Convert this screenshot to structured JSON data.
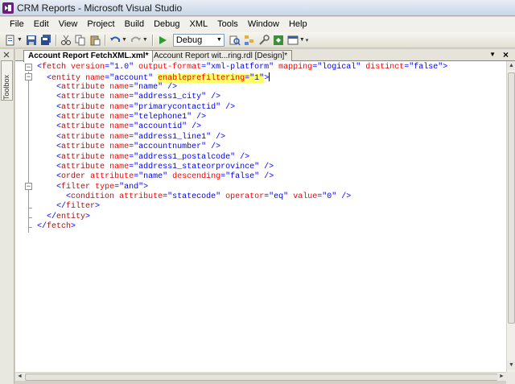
{
  "window": {
    "title": "CRM Reports - Microsoft Visual Studio"
  },
  "menu": [
    "File",
    "Edit",
    "View",
    "Project",
    "Build",
    "Debug",
    "XML",
    "Tools",
    "Window",
    "Help"
  ],
  "toolbar": {
    "configuration": "Debug"
  },
  "toolbox": {
    "label": "Toolbox"
  },
  "tabs": [
    {
      "label": "Account Report FetchXML.xml*",
      "active": true
    },
    {
      "label": "Account Report wit...ring.rdl [Design]*",
      "active": false
    }
  ],
  "tab_close": "×",
  "code_lines": [
    {
      "indent": 0,
      "tokens": [
        [
          "b",
          "<"
        ],
        [
          "t",
          "fetch"
        ],
        [
          "s",
          " "
        ],
        [
          "a",
          "version"
        ],
        [
          "b",
          "="
        ],
        [
          "v",
          "\"1.0\""
        ],
        [
          "s",
          " "
        ],
        [
          "a",
          "output-format"
        ],
        [
          "b",
          "="
        ],
        [
          "v",
          "\"xml-platform\""
        ],
        [
          "s",
          " "
        ],
        [
          "a",
          "mapping"
        ],
        [
          "b",
          "="
        ],
        [
          "v",
          "\"logical\""
        ],
        [
          "s",
          " "
        ],
        [
          "a",
          "distinct"
        ],
        [
          "b",
          "="
        ],
        [
          "v",
          "\"false\""
        ],
        [
          "b",
          ">"
        ]
      ]
    },
    {
      "indent": 1,
      "tokens": [
        [
          "b",
          "<"
        ],
        [
          "t",
          "entity"
        ],
        [
          "s",
          " "
        ],
        [
          "a",
          "name"
        ],
        [
          "b",
          "="
        ],
        [
          "v",
          "\"account\""
        ],
        [
          "s",
          " "
        ],
        [
          "ha",
          "enableprefiltering"
        ],
        [
          "hb",
          "="
        ],
        [
          "hv",
          "\"1\""
        ],
        [
          "b",
          ">"
        ],
        [
          "caret",
          ""
        ]
      ]
    },
    {
      "indent": 2,
      "tokens": [
        [
          "b",
          "<"
        ],
        [
          "t",
          "attribute"
        ],
        [
          "s",
          " "
        ],
        [
          "a",
          "name"
        ],
        [
          "b",
          "="
        ],
        [
          "v",
          "\"name\""
        ],
        [
          "s",
          " "
        ],
        [
          "b",
          "/>"
        ]
      ]
    },
    {
      "indent": 2,
      "tokens": [
        [
          "b",
          "<"
        ],
        [
          "t",
          "attribute"
        ],
        [
          "s",
          " "
        ],
        [
          "a",
          "name"
        ],
        [
          "b",
          "="
        ],
        [
          "v",
          "\"address1_city\""
        ],
        [
          "s",
          " "
        ],
        [
          "b",
          "/>"
        ]
      ]
    },
    {
      "indent": 2,
      "tokens": [
        [
          "b",
          "<"
        ],
        [
          "t",
          "attribute"
        ],
        [
          "s",
          " "
        ],
        [
          "a",
          "name"
        ],
        [
          "b",
          "="
        ],
        [
          "v",
          "\"primarycontactid\""
        ],
        [
          "s",
          " "
        ],
        [
          "b",
          "/>"
        ]
      ]
    },
    {
      "indent": 2,
      "tokens": [
        [
          "b",
          "<"
        ],
        [
          "t",
          "attribute"
        ],
        [
          "s",
          " "
        ],
        [
          "a",
          "name"
        ],
        [
          "b",
          "="
        ],
        [
          "v",
          "\"telephone1\""
        ],
        [
          "s",
          " "
        ],
        [
          "b",
          "/>"
        ]
      ]
    },
    {
      "indent": 2,
      "tokens": [
        [
          "b",
          "<"
        ],
        [
          "t",
          "attribute"
        ],
        [
          "s",
          " "
        ],
        [
          "a",
          "name"
        ],
        [
          "b",
          "="
        ],
        [
          "v",
          "\"accountid\""
        ],
        [
          "s",
          " "
        ],
        [
          "b",
          "/>"
        ]
      ]
    },
    {
      "indent": 2,
      "tokens": [
        [
          "b",
          "<"
        ],
        [
          "t",
          "attribute"
        ],
        [
          "s",
          " "
        ],
        [
          "a",
          "name"
        ],
        [
          "b",
          "="
        ],
        [
          "v",
          "\"address1_line1\""
        ],
        [
          "s",
          " "
        ],
        [
          "b",
          "/>"
        ]
      ]
    },
    {
      "indent": 2,
      "tokens": [
        [
          "b",
          "<"
        ],
        [
          "t",
          "attribute"
        ],
        [
          "s",
          " "
        ],
        [
          "a",
          "name"
        ],
        [
          "b",
          "="
        ],
        [
          "v",
          "\"accountnumber\""
        ],
        [
          "s",
          " "
        ],
        [
          "b",
          "/>"
        ]
      ]
    },
    {
      "indent": 2,
      "tokens": [
        [
          "b",
          "<"
        ],
        [
          "t",
          "attribute"
        ],
        [
          "s",
          " "
        ],
        [
          "a",
          "name"
        ],
        [
          "b",
          "="
        ],
        [
          "v",
          "\"address1_postalcode\""
        ],
        [
          "s",
          " "
        ],
        [
          "b",
          "/>"
        ]
      ]
    },
    {
      "indent": 2,
      "tokens": [
        [
          "b",
          "<"
        ],
        [
          "t",
          "attribute"
        ],
        [
          "s",
          " "
        ],
        [
          "a",
          "name"
        ],
        [
          "b",
          "="
        ],
        [
          "v",
          "\"address1_stateorprovince\""
        ],
        [
          "s",
          " "
        ],
        [
          "b",
          "/>"
        ]
      ]
    },
    {
      "indent": 2,
      "tokens": [
        [
          "b",
          "<"
        ],
        [
          "t",
          "order"
        ],
        [
          "s",
          " "
        ],
        [
          "a",
          "attribute"
        ],
        [
          "b",
          "="
        ],
        [
          "v",
          "\"name\""
        ],
        [
          "s",
          " "
        ],
        [
          "a",
          "descending"
        ],
        [
          "b",
          "="
        ],
        [
          "v",
          "\"false\""
        ],
        [
          "s",
          " "
        ],
        [
          "b",
          "/>"
        ]
      ]
    },
    {
      "indent": 2,
      "tokens": [
        [
          "b",
          "<"
        ],
        [
          "t",
          "filter"
        ],
        [
          "s",
          " "
        ],
        [
          "a",
          "type"
        ],
        [
          "b",
          "="
        ],
        [
          "v",
          "\"and\""
        ],
        [
          "b",
          ">"
        ]
      ]
    },
    {
      "indent": 3,
      "tokens": [
        [
          "b",
          "<"
        ],
        [
          "t",
          "condition"
        ],
        [
          "s",
          " "
        ],
        [
          "a",
          "attribute"
        ],
        [
          "b",
          "="
        ],
        [
          "v",
          "\"statecode\""
        ],
        [
          "s",
          " "
        ],
        [
          "a",
          "operator"
        ],
        [
          "b",
          "="
        ],
        [
          "v",
          "\"eq\""
        ],
        [
          "s",
          " "
        ],
        [
          "a",
          "value"
        ],
        [
          "b",
          "="
        ],
        [
          "v",
          "\"0\""
        ],
        [
          "s",
          " "
        ],
        [
          "b",
          "/>"
        ]
      ]
    },
    {
      "indent": 2,
      "tokens": [
        [
          "b",
          "</"
        ],
        [
          "t",
          "filter"
        ],
        [
          "b",
          ">"
        ]
      ]
    },
    {
      "indent": 1,
      "tokens": [
        [
          "b",
          "</"
        ],
        [
          "t",
          "entity"
        ],
        [
          "b",
          ">"
        ]
      ]
    },
    {
      "indent": 0,
      "tokens": [
        [
          "b",
          "</"
        ],
        [
          "t",
          "fetch"
        ],
        [
          "b",
          ">"
        ]
      ]
    }
  ]
}
